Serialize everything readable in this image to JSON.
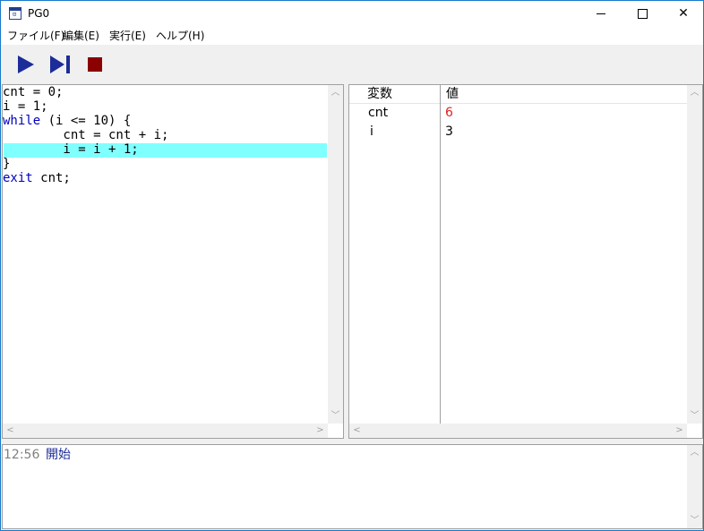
{
  "window": {
    "title": "PG0",
    "icon_name": "app-window-icon",
    "controls": [
      "minimize-icon",
      "maximize-icon",
      "close-icon"
    ],
    "close_glyph": "✕"
  },
  "menu": {
    "items": [
      {
        "label": "ファイル(F)"
      },
      {
        "label": "編集(E)"
      },
      {
        "label": "実行(E)"
      },
      {
        "label": "ヘルプ(H)"
      }
    ]
  },
  "toolbar": {
    "buttons": [
      {
        "name": "run",
        "icon": "play-icon",
        "color": "#1c2c98"
      },
      {
        "name": "step",
        "icon": "step-forward-icon",
        "color": "#1c2c98"
      },
      {
        "name": "stop",
        "icon": "stop-icon",
        "color": "#8b0000"
      }
    ]
  },
  "code": {
    "lines": [
      {
        "keyword": "",
        "text": "cnt = 0;"
      },
      {
        "keyword": "",
        "text": "i = 1;"
      },
      {
        "keyword": "while",
        "text": " (i <= 10) {"
      },
      {
        "keyword": "",
        "text": "        cnt = cnt + i;"
      },
      {
        "keyword": "",
        "text": "        i = i + 1;"
      },
      {
        "keyword": "",
        "text": "}"
      },
      {
        "keyword": "exit",
        "text": " cnt;"
      }
    ],
    "highlighted_line": 5,
    "highlight_color": "#80ffff",
    "keyword_color": "#0000c0"
  },
  "variables": {
    "headers": {
      "name": "変数",
      "value": "値"
    },
    "rows": [
      {
        "name": "cnt",
        "value": "6",
        "changed": true
      },
      {
        "name": "i",
        "value": "3",
        "changed": false
      }
    ],
    "changed_color": "#e02020"
  },
  "log": {
    "entries": [
      {
        "time": "12:56",
        "message": "開始"
      }
    ]
  }
}
